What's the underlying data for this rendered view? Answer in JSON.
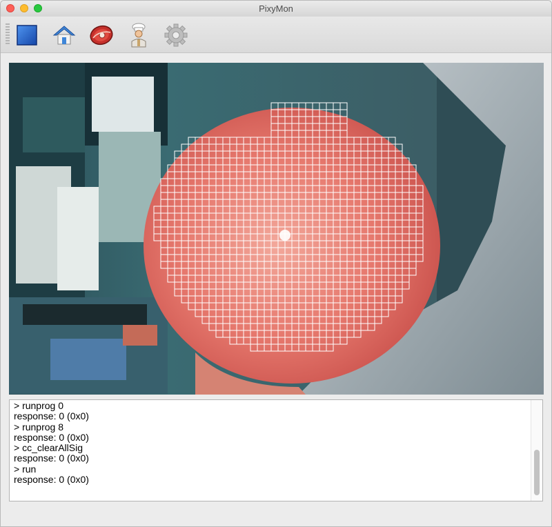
{
  "window": {
    "title": "PixyMon"
  },
  "toolbar": {
    "buttons": [
      {
        "name": "stop",
        "icon": "blue-square-icon"
      },
      {
        "name": "home",
        "icon": "house-icon"
      },
      {
        "name": "raw",
        "icon": "steak-icon"
      },
      {
        "name": "cooked",
        "icon": "chef-icon"
      },
      {
        "name": "configure",
        "icon": "gear-icon"
      }
    ]
  },
  "console": {
    "lines": [
      "> runprog 0",
      "response: 0 (0x0)",
      "> runprog 8",
      "response: 0 (0x0)",
      "> cc_clearAllSig",
      "response: 0 (0x0)",
      "> run",
      "response: 0 (0x0)"
    ]
  },
  "colors": {
    "accent_blue": "#2a6fd1",
    "object_red": "#e5786f",
    "scene_teal": "#2f5e66"
  }
}
